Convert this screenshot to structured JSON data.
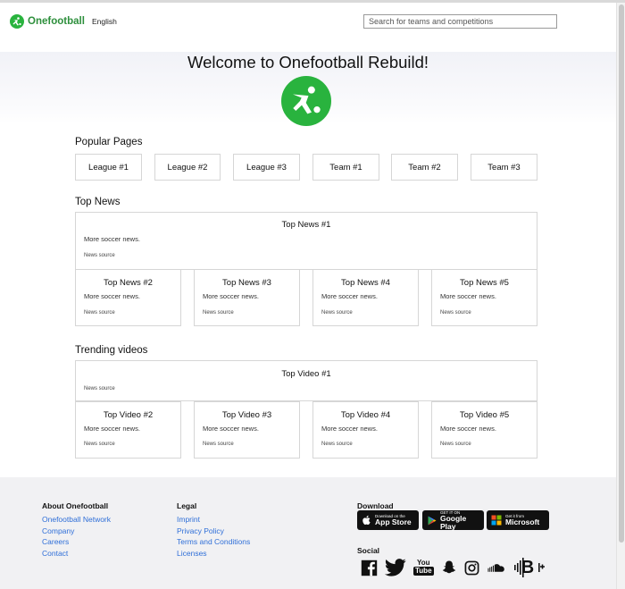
{
  "header": {
    "brand": "Onefootball",
    "language": "English",
    "search_placeholder": "Search for teams and competitions"
  },
  "hero": {
    "title": "Welcome to Onefootball Rebuild!"
  },
  "popular": {
    "title": "Popular Pages",
    "items": [
      "League #1",
      "League #2",
      "League #3",
      "Team #1",
      "Team #2",
      "Team #3"
    ]
  },
  "news": {
    "title": "Top News",
    "featured": {
      "title": "Top News #1",
      "desc": "More soccer news.",
      "source": "News source"
    },
    "items": [
      {
        "title": "Top News #2",
        "desc": "More soccer news.",
        "source": "News source"
      },
      {
        "title": "Top News #3",
        "desc": "More soccer news.",
        "source": "News source"
      },
      {
        "title": "Top News #4",
        "desc": "More soccer news.",
        "source": "News source"
      },
      {
        "title": "Top News #5",
        "desc": "More soccer news.",
        "source": "News source"
      }
    ]
  },
  "videos": {
    "title": "Trending videos",
    "featured": {
      "title": "Top Video #1",
      "source": "News source"
    },
    "items": [
      {
        "title": "Top Video #2",
        "desc": "More soccer news.",
        "source": "News source"
      },
      {
        "title": "Top Video #3",
        "desc": "More soccer news.",
        "source": "News source"
      },
      {
        "title": "Top Video #4",
        "desc": "More soccer news.",
        "source": "News source"
      },
      {
        "title": "Top Video #5",
        "desc": "More soccer news.",
        "source": "News source"
      }
    ]
  },
  "footer": {
    "about": {
      "title": "About Onefootball",
      "links": [
        "Onefootball Network",
        "Company",
        "Careers",
        "Contact"
      ]
    },
    "legal": {
      "title": "Legal",
      "links": [
        "Imprint",
        "Privacy Policy",
        "Terms and Conditions",
        "Licenses"
      ]
    },
    "download": {
      "title": "Download",
      "appstore": {
        "small": "Download on the",
        "big": "App Store"
      },
      "googleplay": {
        "small": "GET IT ON",
        "big": "Google Play"
      },
      "microsoft": {
        "small": "Get it from",
        "big": "Microsoft"
      }
    },
    "social": {
      "title": "Social",
      "icons": [
        "facebook-icon",
        "twitter-icon",
        "youtube-icon",
        "snapchat-icon",
        "instagram-icon",
        "soundcloud-icon",
        "deezer-icon"
      ],
      "youtube_top": "You",
      "youtube_bottom": "Tube",
      "deezer_letter": "B"
    }
  },
  "colors": {
    "brand_green": "#29b33e",
    "link_blue": "#2f6fd8",
    "footer_bg": "#f1f1f3"
  }
}
